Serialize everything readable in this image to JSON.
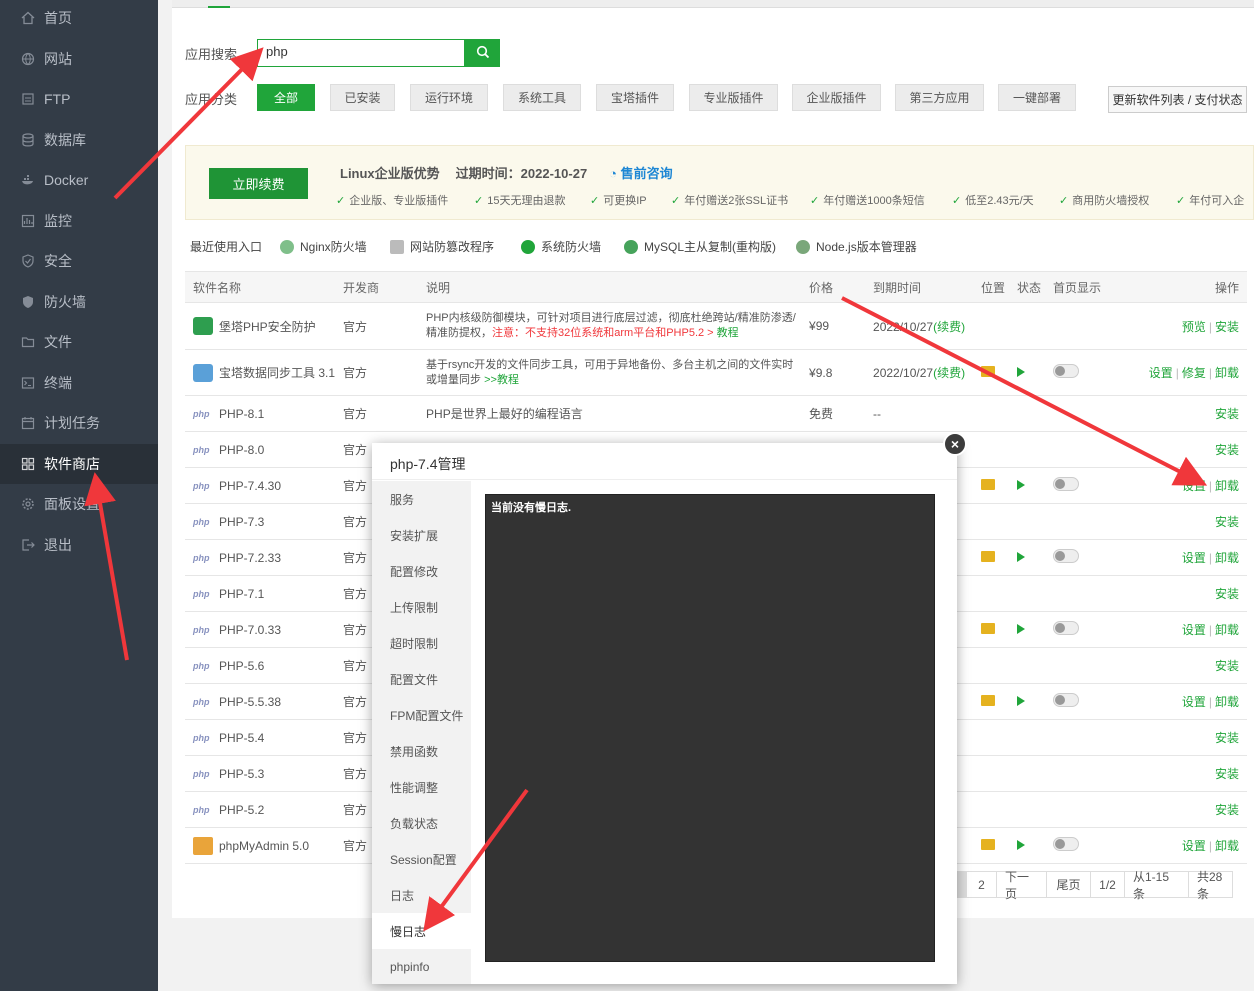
{
  "sidebar": {
    "items": [
      {
        "label": "首页",
        "icon": "home-icon"
      },
      {
        "label": "网站",
        "icon": "globe-icon"
      },
      {
        "label": "FTP",
        "icon": "ftp-icon"
      },
      {
        "label": "数据库",
        "icon": "database-icon"
      },
      {
        "label": "Docker",
        "icon": "docker-icon"
      },
      {
        "label": "监控",
        "icon": "monitor-icon"
      },
      {
        "label": "安全",
        "icon": "shield-icon"
      },
      {
        "label": "防火墙",
        "icon": "firewall-icon"
      },
      {
        "label": "文件",
        "icon": "folder-icon"
      },
      {
        "label": "终端",
        "icon": "terminal-icon"
      },
      {
        "label": "计划任务",
        "icon": "calendar-icon"
      },
      {
        "label": "软件商店",
        "icon": "apps-icon",
        "active": true
      },
      {
        "label": "面板设置",
        "icon": "gear-icon"
      },
      {
        "label": "退出",
        "icon": "logout-icon"
      }
    ]
  },
  "search": {
    "label": "应用搜索",
    "value": "php"
  },
  "categories": {
    "label": "应用分类",
    "items": [
      "全部",
      "已安装",
      "运行环境",
      "系统工具",
      "宝塔插件",
      "专业版插件",
      "企业版插件",
      "第三方应用",
      "一键部署"
    ],
    "update_button": "更新软件列表 / 支付状态"
  },
  "banner": {
    "renew_button": "立即续费",
    "title": "Linux企业版优势",
    "expiry": "过期时间：2022-10-27",
    "consult": "售前咨询",
    "features": [
      "企业版、专业版插件",
      "15天无理由退款",
      "可更换IP",
      "年付赠送2张SSL证书",
      "年付赠送1000条短信",
      "低至2.43元/天",
      "商用防火墙授权",
      "年付可入企"
    ]
  },
  "recent": {
    "label": "最近使用入口",
    "items": [
      "Nginx防火墙",
      "网站防篡改程序",
      "系统防火墙",
      "MySQL主从复制(重构版)",
      "Node.js版本管理器"
    ]
  },
  "table": {
    "headers": [
      "软件名称",
      "开发商",
      "说明",
      "价格",
      "到期时间",
      "位置",
      "状态",
      "首页显示",
      "操作"
    ],
    "rows": [
      {
        "name": "堡塔PHP安全防护",
        "dev": "官方",
        "desc1": "PHP内核级防御模块，可针对项目进行底层过滤，彻底杜绝跨站/精准防渗透/",
        "desc2_pre": "精准防提权，",
        "desc2_red": "注意：不支持32位系统和arm平台和PHP5.2 >",
        "desc2_link": "教程",
        "price": "¥99",
        "expire": "2022/10/27",
        "renew": "(续费)",
        "ops": [
          "预览",
          "安装"
        ]
      },
      {
        "name": "宝塔数据同步工具 3.1",
        "dev": "官方",
        "desc1": "基于rsync开发的文件同步工具，可用于异地备份、多台主机之间的文件实时",
        "desc2_pre": "或增量同步 ",
        "desc2_link": ">>教程",
        "price": "¥9.8",
        "expire": "2022/10/27",
        "renew": "(续费)",
        "ops": [
          "设置",
          "修复",
          "卸载"
        ]
      },
      {
        "name": "PHP-8.1",
        "dev": "官方",
        "desc1": "PHP是世界上最好的编程语言",
        "price": "免费",
        "expire": "--",
        "ops": [
          "安装"
        ]
      },
      {
        "name": "PHP-8.0",
        "dev": "官方",
        "ops": [
          "安装"
        ]
      },
      {
        "name": "PHP-7.4.30",
        "dev": "官方",
        "ops": [
          "设置",
          "卸载"
        ]
      },
      {
        "name": "PHP-7.3",
        "dev": "官方",
        "ops": [
          "安装"
        ]
      },
      {
        "name": "PHP-7.2.33",
        "dev": "官方",
        "ops": [
          "设置",
          "卸载"
        ]
      },
      {
        "name": "PHP-7.1",
        "dev": "官方",
        "ops": [
          "安装"
        ]
      },
      {
        "name": "PHP-7.0.33",
        "dev": "官方",
        "ops": [
          "设置",
          "卸载"
        ]
      },
      {
        "name": "PHP-5.6",
        "dev": "官方",
        "ops": [
          "安装"
        ]
      },
      {
        "name": "PHP-5.5.38",
        "dev": "官方",
        "ops": [
          "设置",
          "卸载"
        ]
      },
      {
        "name": "PHP-5.4",
        "dev": "官方",
        "ops": [
          "安装"
        ]
      },
      {
        "name": "PHP-5.3",
        "dev": "官方",
        "ops": [
          "安装"
        ]
      },
      {
        "name": "PHP-5.2",
        "dev": "官方",
        "ops": [
          "安装"
        ]
      },
      {
        "name": "phpMyAdmin 5.0",
        "dev": "官方",
        "ops": [
          "设置",
          "卸载"
        ]
      }
    ]
  },
  "pager": [
    "2",
    "下一页",
    "尾页",
    "1/2",
    "从1-15条",
    "共28条"
  ],
  "modal": {
    "title": "php-7.4管理",
    "close": "×",
    "menu": [
      "服务",
      "安装扩展",
      "配置修改",
      "上传限制",
      "超时限制",
      "配置文件",
      "FPM配置文件",
      "禁用函数",
      "性能调整",
      "负载状态",
      "Session配置",
      "日志",
      "慢日志",
      "phpinfo"
    ],
    "active_menu": "慢日志",
    "log_text": "当前没有慢日志."
  },
  "colors": {
    "accent": "#20a53a",
    "sidebar": "#333c47",
    "arrow": "#f0373b"
  }
}
